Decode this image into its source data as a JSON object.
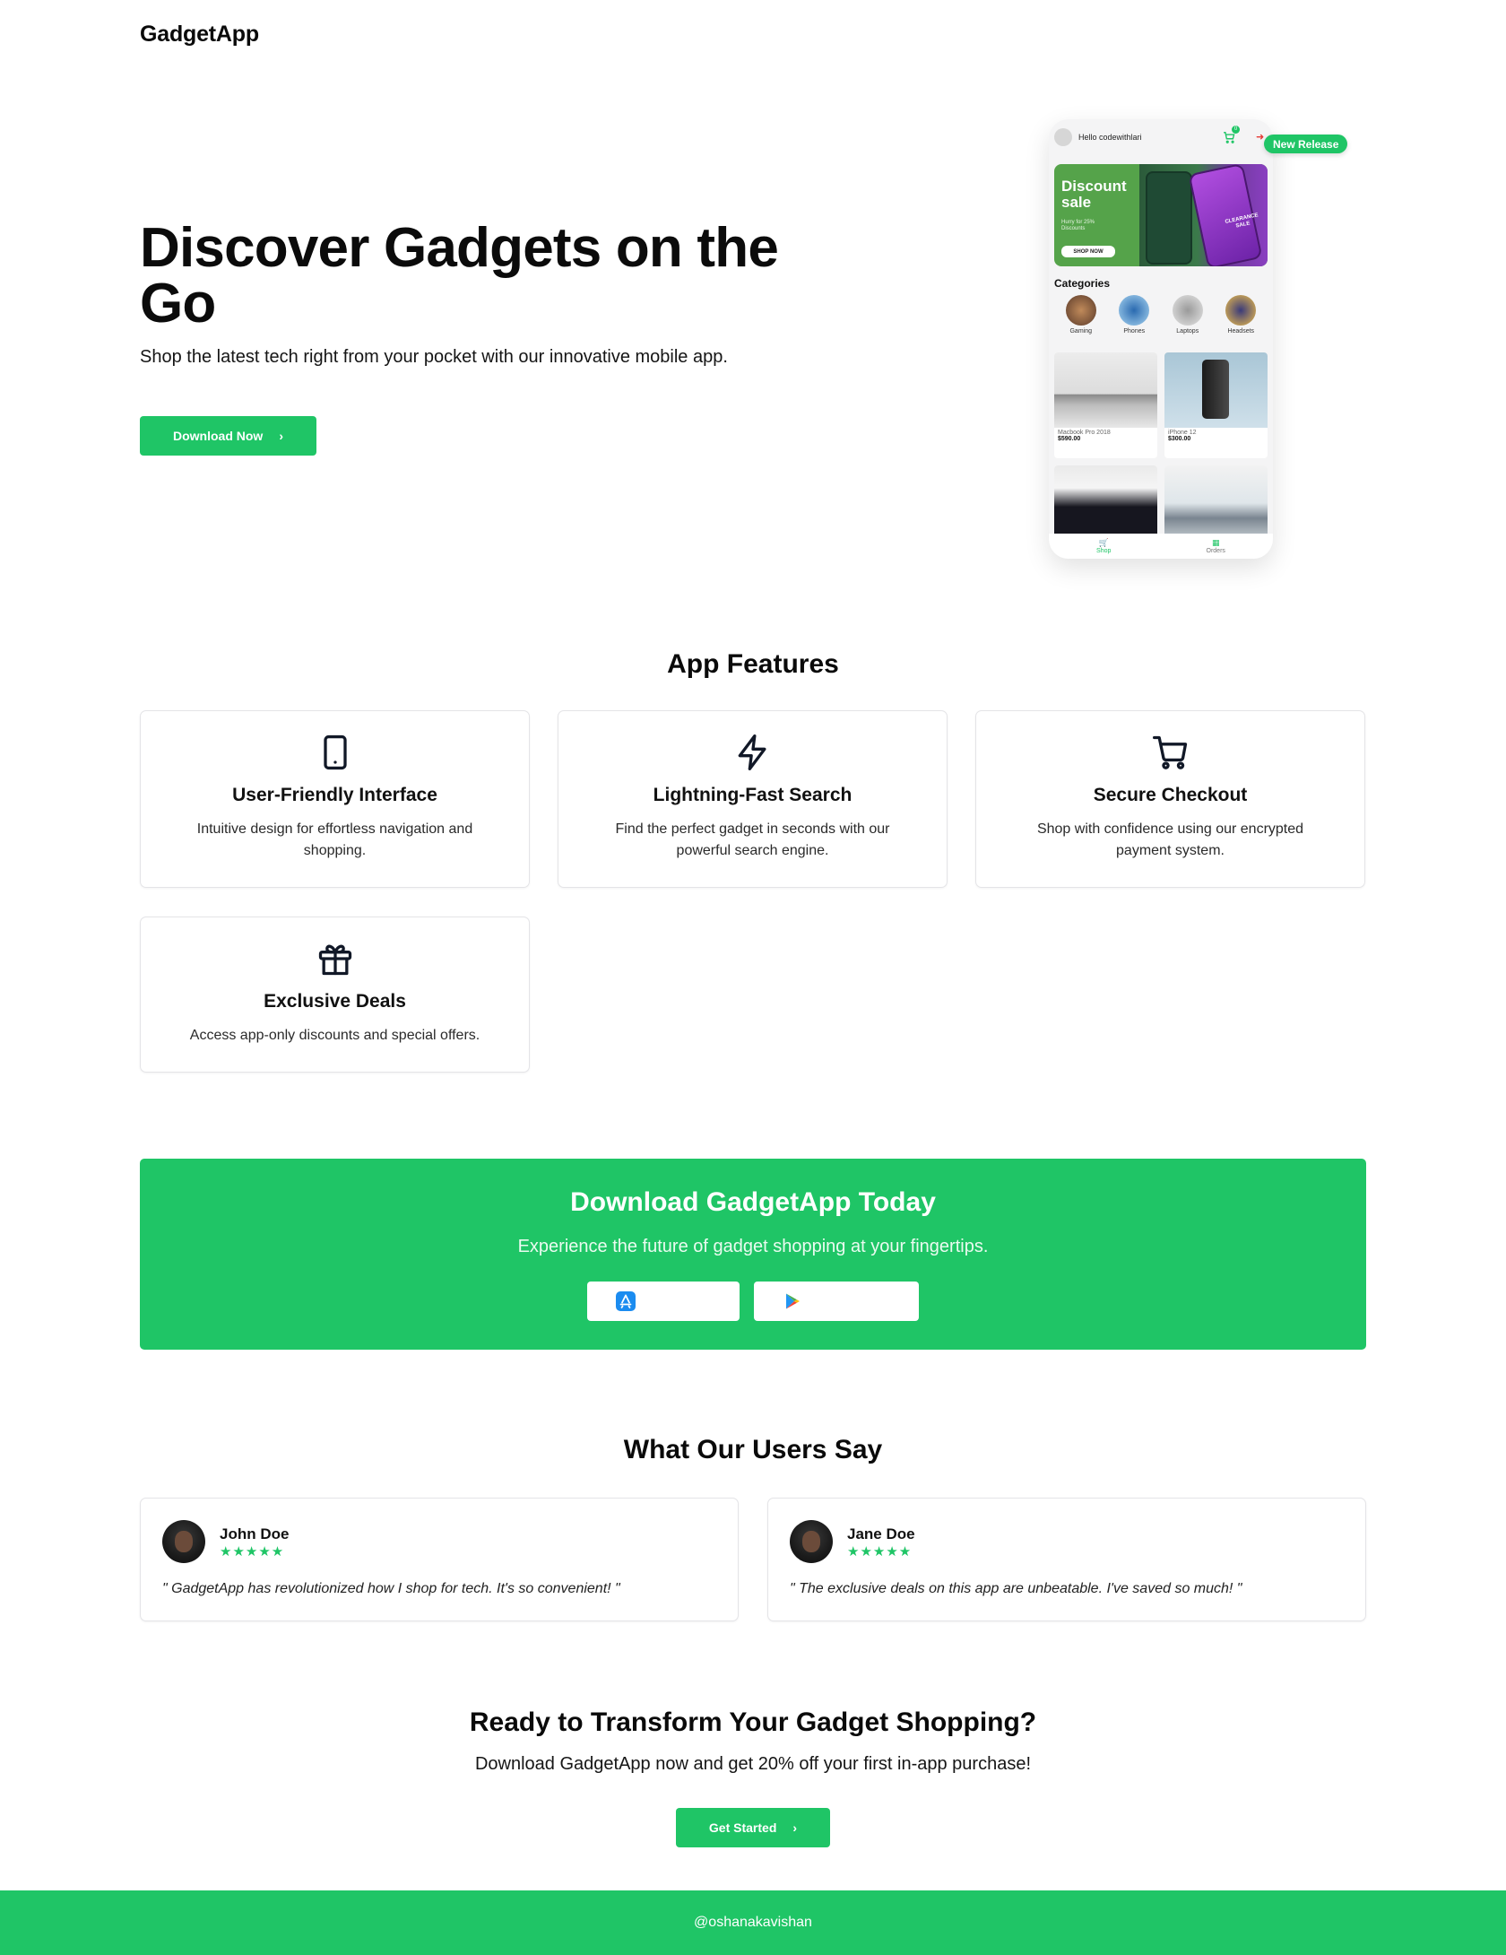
{
  "header": {
    "brand": "GadgetApp"
  },
  "hero": {
    "title": "Discover Gadgets on the Go",
    "subtitle": "Shop the latest tech right from your pocket with our innovative mobile app.",
    "cta_label": "Download Now",
    "cta_icon": "chevron-right-icon"
  },
  "phone_mockup": {
    "badge": "New Release",
    "greeting": "Hello codewithlari",
    "cart_count": "0",
    "banner": {
      "title": "Discount sale",
      "note": "Hurry for 25% Discounts",
      "button": "SHOP NOW",
      "tag": "CLEARANCE SALE"
    },
    "categories_title": "Categories",
    "categories": [
      {
        "label": "Gaming",
        "color": "#8a5a3a"
      },
      {
        "label": "Phones",
        "color": "#4a8ac8"
      },
      {
        "label": "Laptops",
        "color": "#b9b9b9"
      },
      {
        "label": "Headsets",
        "color": "#d9a23a"
      }
    ],
    "products": [
      {
        "name": "Macbook Pro 2018",
        "price": "$590.00"
      },
      {
        "name": "iPhone 12",
        "price": "$300.00"
      },
      {
        "name": "",
        "price": ""
      },
      {
        "name": "",
        "price": ""
      }
    ],
    "nav": [
      {
        "label": "Shop",
        "icon": "cart-icon"
      },
      {
        "label": "Orders",
        "icon": "orders-icon"
      }
    ]
  },
  "features": {
    "title": "App Features",
    "items": [
      {
        "icon": "smartphone-icon",
        "title": "User-Friendly Interface",
        "desc": "Intuitive design for effortless navigation and shopping."
      },
      {
        "icon": "lightning-icon",
        "title": "Lightning-Fast Search",
        "desc": "Find the perfect gadget in seconds with our powerful search engine."
      },
      {
        "icon": "cart-icon",
        "title": "Secure Checkout",
        "desc": "Shop with confidence using our encrypted payment system."
      },
      {
        "icon": "gift-icon",
        "title": "Exclusive Deals",
        "desc": "Access app-only discounts and special offers."
      }
    ]
  },
  "download": {
    "title": "Download GadgetApp Today",
    "subtitle": "Experience the future of gadget shopping at your fingertips.",
    "app_store_label": "App Store",
    "google_play_label": "Google Play"
  },
  "testimonials": {
    "title": "What Our Users Say",
    "items": [
      {
        "name": "John Doe",
        "stars": "★★★★★",
        "quote": "\" GadgetApp has revolutionized how I shop for tech. It's so convenient! \""
      },
      {
        "name": "Jane Doe",
        "stars": "★★★★★",
        "quote": "\" The exclusive deals on this app are unbeatable. I've saved so much! \""
      }
    ]
  },
  "cta": {
    "title": "Ready to Transform Your Gadget Shopping?",
    "subtitle": "Download GadgetApp now and get 20% off your first in-app purchase!",
    "button_label": "Get Started"
  },
  "footer": {
    "text": "@oshanakavishan"
  },
  "colors": {
    "accent": "#1fc566",
    "text": "#0a0a0a",
    "border": "#e4e4e7"
  }
}
